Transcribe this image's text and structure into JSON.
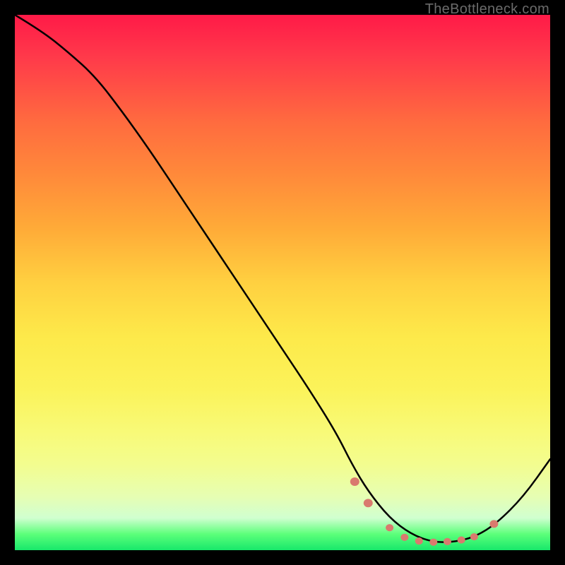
{
  "watermark": "TheBottleneck.com",
  "chart_data": {
    "type": "line",
    "title": "",
    "xlabel": "",
    "ylabel": "",
    "xlim": [
      0,
      100
    ],
    "ylim": [
      0,
      100
    ],
    "background_gradient": {
      "top_color": "#ff1a48",
      "bottom_color": "#17e86b",
      "description": "red-yellow-green vertical gradient"
    },
    "series": [
      {
        "name": "bottleneck-curve",
        "x": [
          0,
          5,
          10,
          15,
          20,
          25,
          30,
          35,
          40,
          45,
          50,
          55,
          60,
          63,
          66,
          70,
          74,
          78,
          82,
          86,
          90,
          95,
          100
        ],
        "y": [
          100,
          97,
          93,
          88.5,
          82,
          75,
          67.5,
          60,
          52.5,
          45,
          37.5,
          30,
          22,
          16,
          11,
          6,
          3,
          1.5,
          1.5,
          2.5,
          5,
          10,
          17
        ],
        "stroke": "#000000",
        "stroke_width": 2
      }
    ],
    "markers": [
      {
        "x": 63.5,
        "y": 12.8,
        "r": 6.5,
        "fill": "#d97a6e"
      },
      {
        "x": 66.0,
        "y": 8.8,
        "r": 6.5,
        "fill": "#d97a6e"
      },
      {
        "x": 70.0,
        "y": 4.2,
        "r": 5.5,
        "fill": "#d97a6e"
      },
      {
        "x": 72.8,
        "y": 2.4,
        "r": 5.5,
        "fill": "#d97a6e"
      },
      {
        "x": 75.5,
        "y": 1.7,
        "r": 5.5,
        "fill": "#d97a6e"
      },
      {
        "x": 78.2,
        "y": 1.5,
        "r": 5.5,
        "fill": "#d97a6e"
      },
      {
        "x": 80.8,
        "y": 1.6,
        "r": 5.5,
        "fill": "#d97a6e"
      },
      {
        "x": 83.4,
        "y": 1.9,
        "r": 5.5,
        "fill": "#d97a6e"
      },
      {
        "x": 85.8,
        "y": 2.5,
        "r": 5.5,
        "fill": "#d97a6e"
      },
      {
        "x": 89.5,
        "y": 4.9,
        "r": 6.0,
        "fill": "#d97a6e"
      }
    ]
  }
}
